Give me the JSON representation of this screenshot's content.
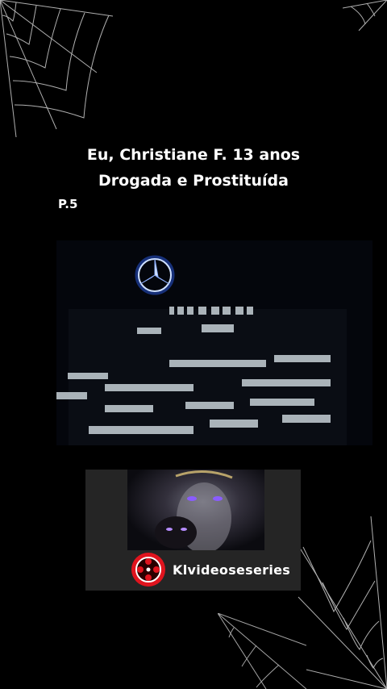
{
  "title": {
    "line1": "Eu, Christiane F. 13 anos",
    "line2": "Drogada e Prostituída"
  },
  "part_label": "P.5",
  "channel": {
    "name": "Klvideoseseries"
  },
  "colors": {
    "background": "#000000",
    "card": "#252525",
    "logo_red": "#e0141e",
    "star_glow": "#2e63ff"
  },
  "icons": {
    "webs": "spider-web-icon",
    "logo": "film-reel-icon",
    "star": "mercedes-star-icon"
  }
}
